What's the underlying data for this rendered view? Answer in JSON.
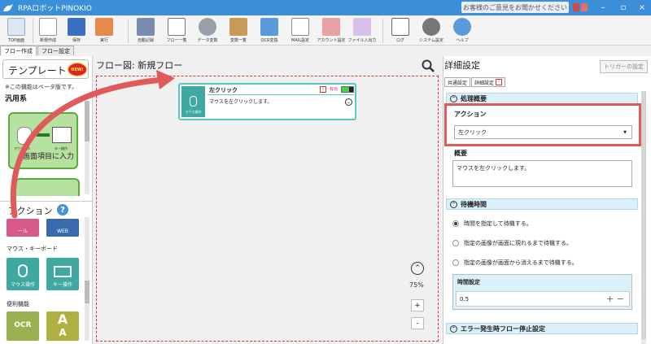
{
  "window": {
    "title": "RPAロボットPINOKIO",
    "feedback": "お客様のご意見をお聞かせください",
    "minimize": "–",
    "maximize": "▫",
    "close": "×"
  },
  "ribbon": {
    "items": [
      {
        "label": "TOP画面"
      },
      {
        "label": "新規作成"
      },
      {
        "label": "保存"
      },
      {
        "label": "実行"
      },
      {
        "label": "自動記録"
      },
      {
        "label": "フロー一覧"
      },
      {
        "label": "データ変数"
      },
      {
        "label": "変数一覧"
      },
      {
        "label": "OCR変換"
      },
      {
        "label": "MAIL設定"
      },
      {
        "label": "アカウント設定"
      },
      {
        "label": "ファイル入出力"
      },
      {
        "label": "ログ"
      },
      {
        "label": "システム設定"
      },
      {
        "label": "ヘルプ"
      }
    ]
  },
  "tabs": [
    {
      "label": "フロー作成"
    },
    {
      "label": "フロー設定"
    }
  ],
  "left": {
    "template_title": "テンプレート",
    "new_badge": "NEW!",
    "beta_note": "※この機能はベータ版です。",
    "category_generic": "汎用系",
    "template_card_label": "画面項目に入力",
    "template_card_sub1": "マウス操作",
    "template_card_sub2": "キー操作",
    "action_title": "アクション",
    "help": "?",
    "partial_tile1": "ール",
    "partial_tile2": "WEB",
    "category_mouse": "マウス・キーボード",
    "tile_mouse": "マウス操作",
    "tile_key": "キー操作",
    "category_convenience": "便利機能",
    "tile_ocr": "OCR"
  },
  "canvas": {
    "title": "フロー図:  新規フロー",
    "zoom_pct": "75%",
    "zoom_in": "+",
    "zoom_out": "-",
    "node": {
      "name": "左クリック",
      "category": "マウス操作",
      "description": "マウスを左クリックします。",
      "status": "有効",
      "warn": "!"
    }
  },
  "right": {
    "title": "詳細設定",
    "trigger_button": "トリガーの設定",
    "tab_common": "共通設定",
    "tab_detail": "詳細設定",
    "warn": "!",
    "section_overview": "処理概要",
    "action_label": "アクション",
    "action_value": "左クリック",
    "summary_label": "概要",
    "summary_value": "マウスを左クリックします。",
    "section_wait": "待機時間",
    "radio1": "時間を指定して待機する。",
    "radio2": "指定の画像が画面に現れるまで待機する。",
    "radio3": "指定の画像が画面から消えるまで待機する。",
    "time_label": "時間設定",
    "time_value": "0.5",
    "section_error": "エラー発生時フロー停止設定"
  },
  "colors": {
    "titlebar": "#3a8fd8",
    "highlight": "#e05a5a",
    "teal": "#3fa8a0",
    "template_green": "#b7e1a1"
  }
}
